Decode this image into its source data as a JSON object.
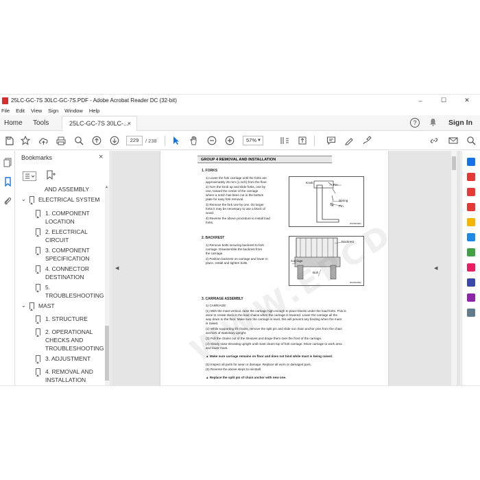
{
  "window": {
    "title": "25LC-GC-7S 30LC-GC-7S.PDF - Adobe Acrobat Reader DC (32-bit)",
    "minimize": "–",
    "maximize": "☐",
    "close": "✕"
  },
  "menu": [
    "File",
    "Edit",
    "View",
    "Sign",
    "Window",
    "Help"
  ],
  "tabs": {
    "home": "Home",
    "tools": "Tools",
    "document": "25LC-GC-7S 30LC-...",
    "close": "×",
    "help": "?",
    "signin": "Sign In"
  },
  "toolbar": {
    "page_current": "229",
    "page_total": "/  238",
    "zoom": "57%"
  },
  "bookmarks": {
    "title": "Bookmarks",
    "close": "×",
    "items": [
      {
        "label": "AND ASSEMBLY",
        "level": 2
      },
      {
        "label": "ELECTRICAL SYSTEM",
        "level": 1,
        "toggle": "⌄"
      },
      {
        "label": "1. COMPONENT",
        "label2": "LOCATION",
        "level": 2
      },
      {
        "label": "2. ELECTRICAL",
        "label2": "CIRCUIT",
        "level": 2
      },
      {
        "label": "3. COMPONENT",
        "label2": "SPECIFICATION",
        "level": 2
      },
      {
        "label": "4. CONNECTOR",
        "label2": "DESTINATION",
        "level": 2
      },
      {
        "label": "5.",
        "label2": "TROUBLESHOOTING",
        "level": 2
      },
      {
        "label": "MAST",
        "level": 1,
        "toggle": "⌄"
      },
      {
        "label": "1. STRUCTURE",
        "level": 2
      },
      {
        "label": "2. OPERATIONAL",
        "label2": "CHECKS AND",
        "label3": "TROUBLESHOOTING",
        "level": 2
      },
      {
        "label": "3. ADJUSTMENT",
        "level": 2
      },
      {
        "label": "4. REMOVAL AND",
        "label2": "INSTALLATION",
        "level": 2
      }
    ]
  },
  "page": {
    "group_title": "GROUP  4  REMOVAL AND INSTALLATION",
    "sec1_title": "1. FORKS",
    "sec1_lines": [
      "1)  Lower the fork carriage until the forks are",
      "      approximately 25 mm (1 inch) from the floor.",
      "2)  Turn the knob up and slide forks, one by",
      "      one, toward the center of the carriage",
      "      where a notch has been cut in the bottom",
      "      plate for easy fork removal.",
      "3)  Remove the fork one by one.  On larger",
      "      forks it may be necessary to use a block of",
      "      wood.",
      "4)  Reverse the above procedure to install load",
      "      forks."
    ],
    "fig1_labels": {
      "knob": "Knob",
      "pin": "Pin",
      "spring": "Spring",
      "pin2": "Pin",
      "code": "D507RM001"
    },
    "sec2_title": "2. BACKREST",
    "sec2_lines": [
      "1)  Remove bolts securing backrest to fork",
      "      carriage. Disassemble the backrest from",
      "      the carriage.",
      "2)  Position backrest on carriage and lower in",
      "      place, install and tighten bolts."
    ],
    "fig2_labels": {
      "backrest": "Backrest",
      "carriage": "Carriage",
      "bolt": "Bolt",
      "code": "D507RM002"
    },
    "sec3_title": "3. CARRIAGE ASSEMBLY",
    "sec3_sub": "1)  CARRIAGE",
    "sec3_lines": [
      "(1)  With the mast vertical, raise the carriage high enough to place blocks under the load forks. This is",
      "       done to create slack in the load chains when the carriage is lowered. Lower the carriage all the",
      "       way down to the floor. Make sure the carriage is level, this will prevent any binding when the mast",
      "       is raised.",
      "(2)  While supporting lift chains, remove the split pin and slide out chain anchor pins from the chain",
      "       anchors of stationary upright.",
      "(3)  Pull the chains out of the sheaves and drape them over the front of the carriage.",
      "(4)  Slowly raise elevating upright until mast clears top of fork carriage. Move carriage to work area",
      "       and lower mast."
    ],
    "warn1": "▲ Make sure carriage remains on floor and does not bind while mast is being raised.",
    "sec3_lines2": [
      "(5)  Inspect all parts for wear or damage.  Replace all worn or damaged pars.",
      "(6)  Reverse the above steps to reinstall."
    ],
    "warn2": "▲ Replace the split pin of chain anchor with new one."
  },
  "colors": {
    "accent": "#1473e6",
    "pdf_red": "#d32f2f"
  }
}
